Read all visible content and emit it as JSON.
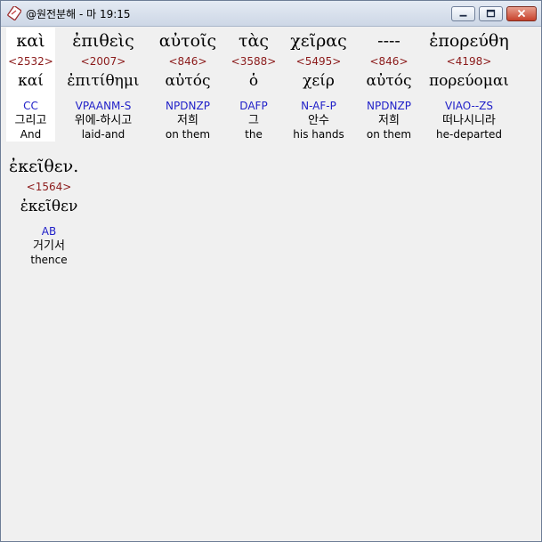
{
  "window": {
    "title": "@원전분해 - 마 19:15",
    "controls": {
      "minimize": "minimize",
      "maximize": "maximize",
      "close": "close"
    }
  },
  "words": [
    {
      "greek": "καὶ",
      "strong": "<2532>",
      "lemma": "καί",
      "parse": "CC",
      "korean": "그리고",
      "english": "And"
    },
    {
      "greek": "ἐπιθεὶς",
      "strong": "<2007>",
      "lemma": "ἐπιτίθημι",
      "parse": "VPAANM-S",
      "korean": "위에-하시고",
      "english": "laid-and"
    },
    {
      "greek": "αὐτοῖς",
      "strong": "<846>",
      "lemma": "αὐτός",
      "parse": "NPDNZP",
      "korean": "저희",
      "english": "on them"
    },
    {
      "greek": "τὰς",
      "strong": "<3588>",
      "lemma": "ὁ",
      "parse": "DAFP",
      "korean": "그",
      "english": "the"
    },
    {
      "greek": "χεῖρας",
      "strong": "<5495>",
      "lemma": "χείρ",
      "parse": "N-AF-P",
      "korean": "안수",
      "english": "his hands"
    },
    {
      "greek": "----",
      "strong": "<846>",
      "lemma": "αὐτός",
      "parse": "NPDNZP",
      "korean": "저희",
      "english": "on them"
    },
    {
      "greek": "ἐπορεύθη",
      "strong": "<4198>",
      "lemma": "πορεύομαι",
      "parse": "VIAO--ZS",
      "korean": "떠나시니라",
      "english": "he-departed"
    },
    {
      "greek": "ἐκεῖθεν.",
      "strong": "<1564>",
      "lemma": "ἐκεῖθεν",
      "parse": "AB",
      "korean": "거기서",
      "english": "thence"
    }
  ]
}
